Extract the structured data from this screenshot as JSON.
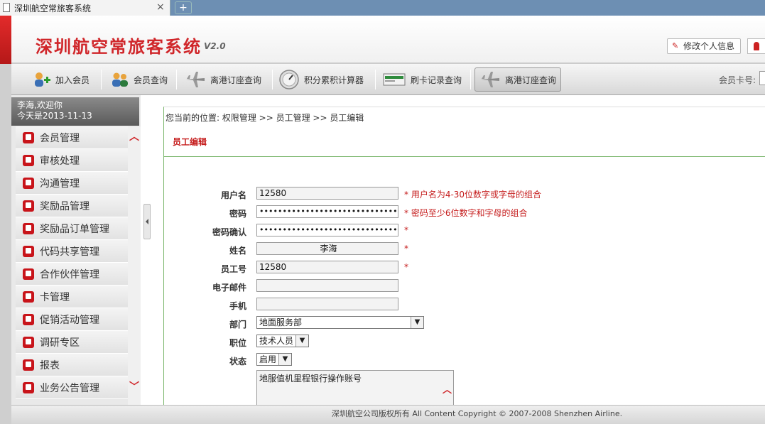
{
  "browser": {
    "tab_title": "深圳航空常旅客系统",
    "close": "×",
    "newtab": "+"
  },
  "header": {
    "brand": "深圳航空常旅客系统",
    "version": "V2.0",
    "edit_profile": "修改个人信息"
  },
  "toolbar": {
    "items": [
      {
        "label": "加入会员",
        "icon": "add-user-icon"
      },
      {
        "label": "会员查询",
        "icon": "users-icon"
      },
      {
        "label": "离港订座查询",
        "icon": "airplane-icon"
      },
      {
        "label": "积分累积计算器",
        "icon": "gauge-icon"
      },
      {
        "label": "刷卡记录查询",
        "icon": "card-reader-icon"
      },
      {
        "label": "离港订座查询",
        "icon": "airplane-icon"
      }
    ],
    "card_label": "会员卡号:"
  },
  "sidebar": {
    "greeting_line1": "李海,欢迎你",
    "greeting_line2": "今天是2013-11-13",
    "items": [
      {
        "label": "会员管理"
      },
      {
        "label": "审核处理"
      },
      {
        "label": "沟通管理"
      },
      {
        "label": "奖励品管理"
      },
      {
        "label": "奖励品订单管理"
      },
      {
        "label": "代码共享管理"
      },
      {
        "label": "合作伙伴管理"
      },
      {
        "label": "卡管理"
      },
      {
        "label": "促销活动管理"
      },
      {
        "label": "调研专区"
      },
      {
        "label": "报表"
      },
      {
        "label": "业务公告管理"
      }
    ]
  },
  "content": {
    "breadcrumb": "您当前的位置: 权限管理 >> 员工管理 >> 员工编辑",
    "section_title": "员工编辑",
    "form": {
      "username_label": "用户名",
      "username_value": "12580",
      "username_hint": "* 用户名为4-30位数字或字母的组合",
      "password_label": "密码",
      "password_value": "••••••••••••••••••••••••••••••",
      "password_hint": "* 密码至少6位数字和字母的组合",
      "confirm_label": "密码确认",
      "confirm_value": "••••••••••••••••••••••••••••••",
      "confirm_hint": "*",
      "name_label": "姓名",
      "name_value": "李海",
      "name_hint": "*",
      "empno_label": "员工号",
      "empno_value": "12580",
      "empno_hint": "*",
      "email_label": "电子邮件",
      "email_value": "",
      "mobile_label": "手机",
      "mobile_value": "",
      "dept_label": "部门",
      "dept_value": "地面服务部",
      "position_label": "职位",
      "position_value": "技术人员",
      "status_label": "状态",
      "status_value": "启用",
      "remark_value": "地服值机里程银行操作账号"
    }
  },
  "footer": {
    "copyright": "深圳航空公司版权所有 All Content Copyright © 2007-2008 Shenzhen Airline."
  }
}
